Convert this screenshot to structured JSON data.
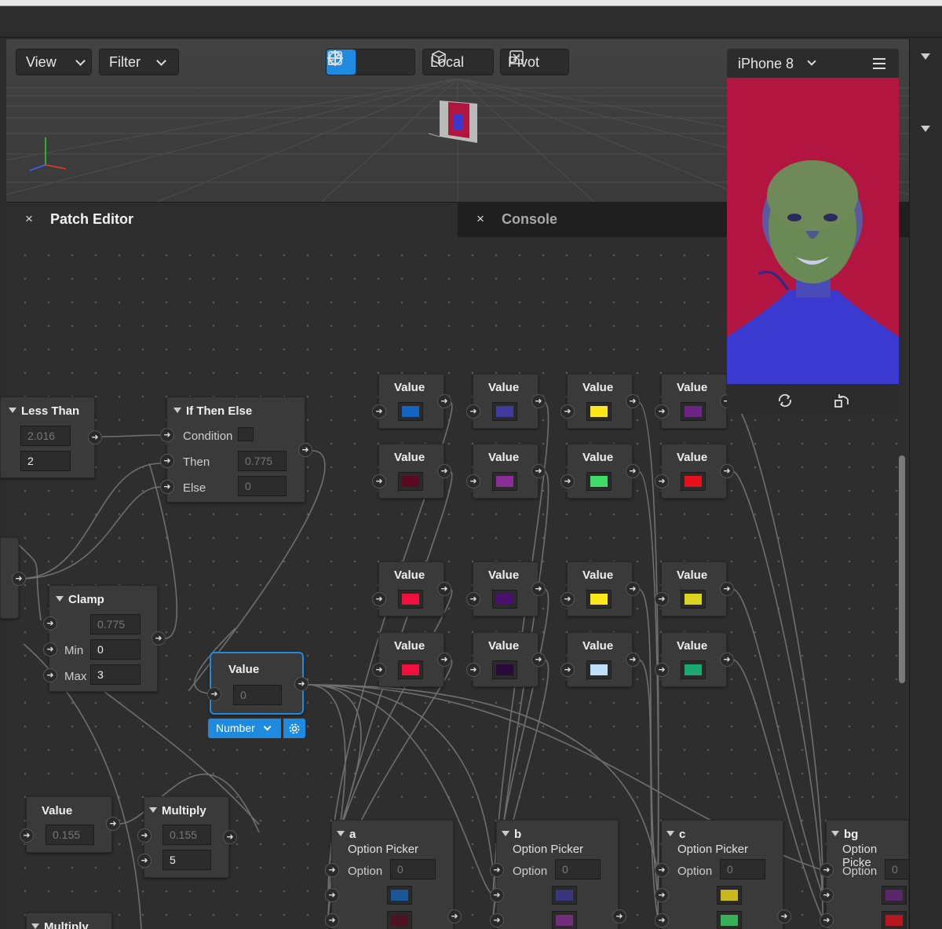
{
  "viewport": {
    "view_label": "View",
    "filter_label": "Filter",
    "local_label": "Local",
    "pivot_label": "Pivot",
    "transform_tools": [
      "move-icon",
      "rotate-icon",
      "scale-icon"
    ]
  },
  "panels": {
    "patch_editor_title": "Patch Editor",
    "console_title": "Console",
    "close_glyph": "×"
  },
  "preview": {
    "device": "iPhone 8",
    "background_color": "#b2153f"
  },
  "nodes": {
    "less_than": {
      "title": "Less Than",
      "input_a": "2.016",
      "input_b": "2"
    },
    "if_then_else": {
      "title": "If Then Else",
      "condition_label": "Condition",
      "then_label": "Then",
      "then_value": "0.775",
      "else_label": "Else",
      "else_value": "0"
    },
    "clamp": {
      "title": "Clamp",
      "input": "0.775",
      "min_label": "Min",
      "min_value": "0",
      "max_label": "Max",
      "max_value": "3"
    },
    "value_selected": {
      "title": "Value",
      "value": "0",
      "type_label": "Number"
    },
    "value_bottom": {
      "title": "Value",
      "value": "0.155"
    },
    "multiply": {
      "title": "Multiply",
      "input_a": "0.155",
      "input_b": "5"
    },
    "multiply_2": {
      "title": "Multiply"
    },
    "color_value_title": "Value",
    "color_values": [
      {
        "color": "#1565c0"
      },
      {
        "color": "#3f3a9c"
      },
      {
        "color": "#ffe81a"
      },
      {
        "color": "#6a2483"
      },
      {
        "color": "#5c0a23"
      },
      {
        "color": "#8a2d96"
      },
      {
        "color": "#3ddd6a"
      },
      {
        "color": "#e8101c"
      },
      {
        "color": "#f0103e"
      },
      {
        "color": "#4a1070"
      },
      {
        "color": "#ffe81a"
      },
      {
        "color": "#d8d420"
      },
      {
        "color": "#f0103e"
      },
      {
        "color": "#2a0a3a"
      },
      {
        "color": "#bfe0fa"
      },
      {
        "color": "#1aa870"
      }
    ],
    "option_pickers": [
      {
        "name": "a",
        "subtitle": "Option Picker",
        "option_label": "Option",
        "option_value": "0",
        "c1": "#1565c0",
        "c2": "#5c0a23"
      },
      {
        "name": "b",
        "subtitle": "Option Picker",
        "option_label": "Option",
        "option_value": "0",
        "c1": "#3f3a9c",
        "c2": "#8a2d96"
      },
      {
        "name": "c",
        "subtitle": "Option Picker",
        "option_label": "Option",
        "option_value": "0",
        "c1": "#ffe81a",
        "c2": "#3ddd6a"
      },
      {
        "name": "bg",
        "subtitle": "Option Picke",
        "option_label": "Option",
        "option_value": "0",
        "c1": "#6a2483",
        "c2": "#e8101c"
      }
    ]
  }
}
